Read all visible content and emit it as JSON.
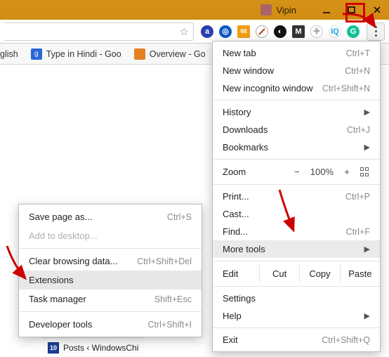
{
  "titlebar": {
    "profile_name": "Vipin"
  },
  "bookmarks": [
    {
      "label": "glish"
    },
    {
      "label": "Type in Hindi - Goo"
    },
    {
      "label": "Overview - Go"
    }
  ],
  "menu": {
    "new_tab": {
      "label": "New tab",
      "shortcut": "Ctrl+T"
    },
    "new_window": {
      "label": "New window",
      "shortcut": "Ctrl+N"
    },
    "new_incognito": {
      "label": "New incognito window",
      "shortcut": "Ctrl+Shift+N"
    },
    "history": {
      "label": "History"
    },
    "downloads": {
      "label": "Downloads",
      "shortcut": "Ctrl+J"
    },
    "bookmarks": {
      "label": "Bookmarks"
    },
    "zoom_label": "Zoom",
    "zoom_value": "100%",
    "print": {
      "label": "Print...",
      "shortcut": "Ctrl+P"
    },
    "cast": {
      "label": "Cast..."
    },
    "find": {
      "label": "Find...",
      "shortcut": "Ctrl+F"
    },
    "more_tools": {
      "label": "More tools"
    },
    "edit_label": "Edit",
    "cut": "Cut",
    "copy": "Copy",
    "paste": "Paste",
    "settings": {
      "label": "Settings"
    },
    "help": {
      "label": "Help"
    },
    "exit": {
      "label": "Exit",
      "shortcut": "Ctrl+Shift+Q"
    }
  },
  "submenu": {
    "save_page": {
      "label": "Save page as...",
      "shortcut": "Ctrl+S"
    },
    "add_desktop": {
      "label": "Add to desktop..."
    },
    "clear_browsing": {
      "label": "Clear browsing data...",
      "shortcut": "Ctrl+Shift+Del"
    },
    "extensions": {
      "label": "Extensions"
    },
    "task_manager": {
      "label": "Task manager",
      "shortcut": "Shift+Esc"
    },
    "dev_tools": {
      "label": "Developer tools",
      "shortcut": "Ctrl+Shift+I"
    }
  },
  "taskbar": {
    "item1": "Posts ‹ WindowsChi"
  }
}
